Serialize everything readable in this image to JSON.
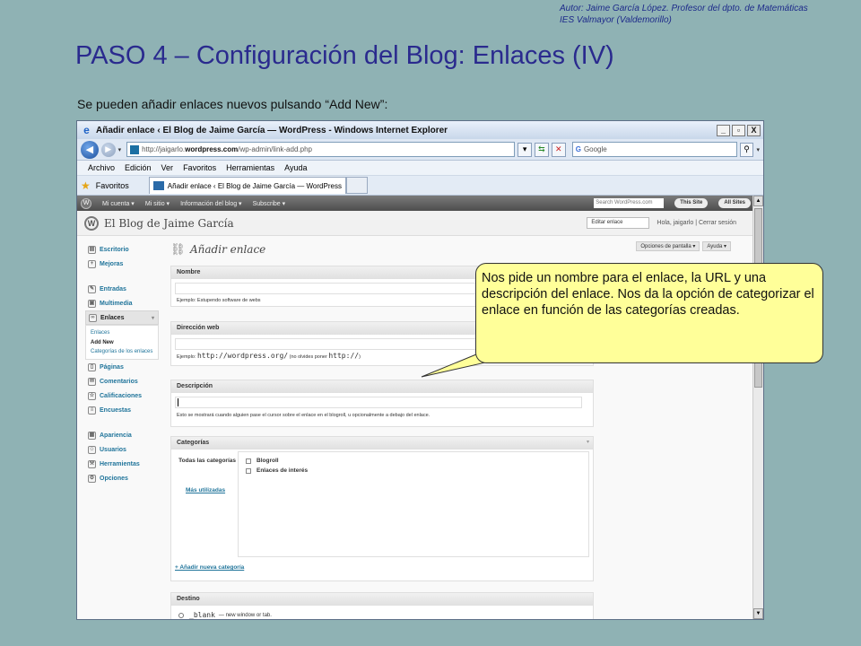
{
  "slide": {
    "author_line1": "Autor: Jaime García López. Profesor del dpto. de Matemáticas",
    "author_line2": "IES Valmayor (Valdemorillo)",
    "title": "PASO 4 – Configuración del Blog: Enlaces (IV)",
    "subtitle": "Se pueden añadir enlaces nuevos pulsando “Add New”:"
  },
  "browser": {
    "window_title": "Añadir enlace ‹ El Blog de Jaime García — WordPress - Windows Internet Explorer",
    "win_min": "_",
    "win_max": "▫",
    "win_close": "X",
    "url_prefix": "http://jaigarlo.",
    "url_host": "wordpress.com",
    "url_path": "/wp-admin/link-add.php",
    "search_placeholder": "Google",
    "menu": [
      "Archivo",
      "Edición",
      "Ver",
      "Favoritos",
      "Herramientas",
      "Ayuda"
    ],
    "favorites_label": "Favoritos",
    "tab_label": "Añadir enlace ‹ El Blog de Jaime García — WordPress"
  },
  "wp": {
    "admin_bar": [
      "Mi cuenta ▾",
      "Mi sitio ▾",
      "Información del blog ▾",
      "Subscribe ▾"
    ],
    "admin_search": "Search WordPress.com",
    "this_site": "This Site",
    "all_sites": "All Sites",
    "blog_name": "El Blog de Jaime García",
    "edit_select": "Editar enlace",
    "user_line": "Hola, jaigarlo | Cerrar sesión",
    "screen_options": "Opciones de pantalla ▾",
    "help": "Ayuda ▾",
    "sidebar": {
      "escritorio": "Escritorio",
      "mejoras": "Mejoras",
      "entradas": "Entradas",
      "multimedia": "Multimedia",
      "enlaces": "Enlaces",
      "sub_enlaces": "Enlaces",
      "sub_add_new": "Add New",
      "sub_categorias": "Categorías de los enlaces",
      "paginas": "Páginas",
      "comentarios": "Comentarios",
      "calificaciones": "Calificaciones",
      "encuestas": "Encuestas",
      "apariencia": "Apariencia",
      "usuarios": "Usuarios",
      "herramientas": "Herramientas",
      "opciones": "Opciones"
    },
    "page_title": "Añadir enlace",
    "nombre": {
      "header": "Nombre",
      "example": "Ejemplo: Estupendo software de webs"
    },
    "direccion": {
      "header": "Dirección web",
      "example_prefix": "Ejemplo:",
      "example_url": "http://wordpress.org/",
      "example_mid": "(no olvides poner",
      "example_http": "http://",
      "example_end": ")"
    },
    "descripcion": {
      "header": "Descripción",
      "help": "Esto se mostrará cuando alguien pase el cursor sobre el enlace en el blogroll, u opcionalmente a debajo del enlace."
    },
    "categorias": {
      "header": "Categorías",
      "all_label": "Todas las categorías",
      "most_used": "Más utilizadas",
      "items": [
        "Blogroll",
        "Enlaces de interés"
      ],
      "add_new": "+ Añadir nueva categoría"
    },
    "destino": {
      "header": "Destino",
      "option": "_blank",
      "option_desc": "— new window or tab."
    }
  },
  "callout": {
    "text": "Nos pide un nombre para el enlace, la URL y una descripción del enlace. Nos da la opción de categorizar el enlace en función de las categorías creadas."
  },
  "colors": {
    "slide_bg": "#8fb2b4",
    "title_color": "#2a2a8e",
    "callout_bg": "#ffff99",
    "wp_link": "#21759b"
  }
}
